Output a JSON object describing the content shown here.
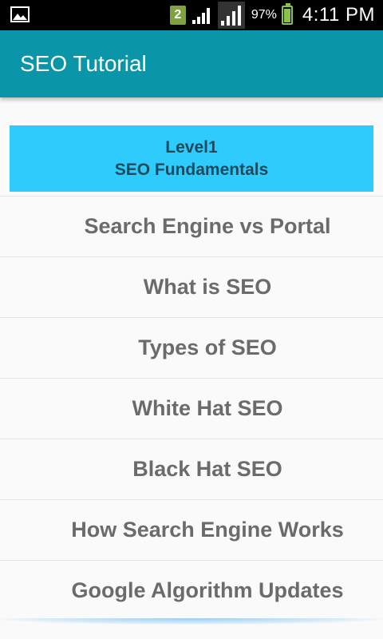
{
  "status_bar": {
    "notification_badge": "2",
    "battery_percent": "97%",
    "battery_level": 0.97,
    "time": "4:11 PM",
    "icons": [
      "gallery-icon",
      "notification-badge-icon",
      "signal-icon",
      "signal-icon-2",
      "battery-icon"
    ]
  },
  "app_bar": {
    "title": "SEO Tutorial",
    "color": "#0a96a8"
  },
  "level_card": {
    "level": "Level1",
    "title": "SEO Fundamentals",
    "color": "#2ecbfc"
  },
  "topics": [
    "Search Engine vs Portal",
    "What is SEO",
    "Types of SEO",
    "White Hat SEO",
    "Black Hat SEO",
    "How Search Engine Works",
    "Google Algorithm Updates"
  ]
}
